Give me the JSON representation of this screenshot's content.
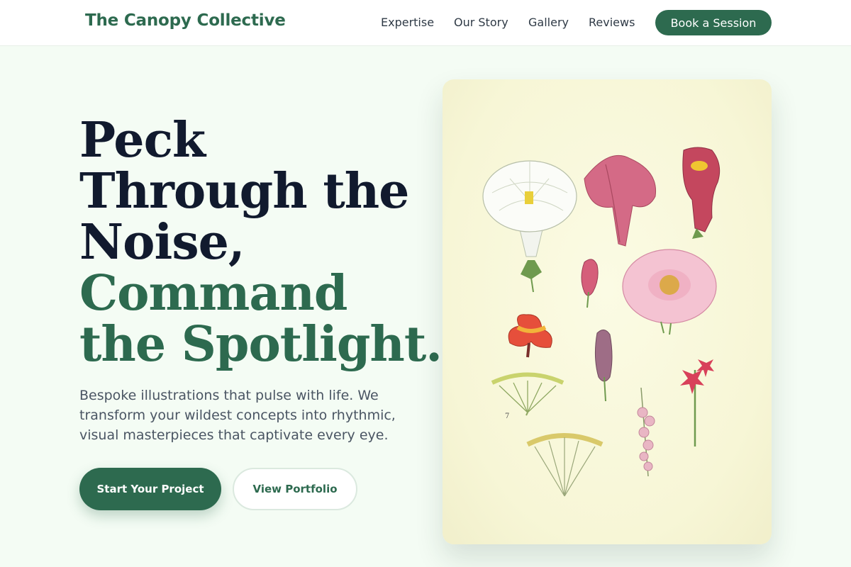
{
  "header": {
    "brand": "The Canopy Collective",
    "nav": [
      "Expertise",
      "Our Story",
      "Gallery",
      "Reviews"
    ],
    "cta": "Book a Session"
  },
  "hero": {
    "title_lines": [
      "Peck",
      "Through the",
      "Noise,",
      "Command",
      "the Spotlight."
    ],
    "subtitle": "Bespoke illustrations that pulse with life. We transform your wildest concepts into rhythmic, visual masterpieces that captivate every eye.",
    "primary_button": "Start Your Project",
    "secondary_button": "View Portfolio",
    "image_alt": "botanical illustration of assorted flowers"
  },
  "colors": {
    "brand_green": "#2d6a4f",
    "heading_dark": "#111a2e",
    "page_background": "#f4fcf4",
    "card_background": "#f7f6d6"
  }
}
